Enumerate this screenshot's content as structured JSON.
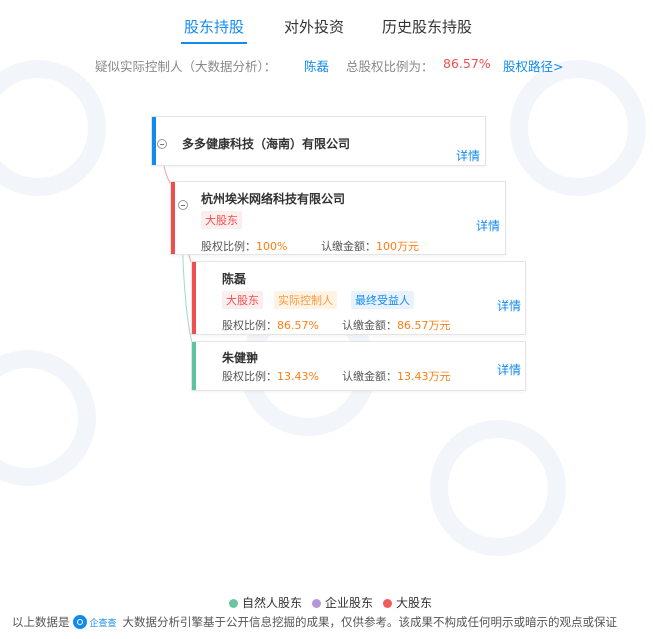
{
  "tabs": [
    {
      "label": "股东持股",
      "active": true
    },
    {
      "label": "对外投资",
      "active": false
    },
    {
      "label": "历史股东持股",
      "active": false
    }
  ],
  "controller": {
    "prefix": "疑似实际控制人（大数据分析）：",
    "name": "陈磊",
    "ratio_label": "总股权比例为：",
    "ratio_value": "86.57%",
    "path_link": "股权路径>"
  },
  "tree": {
    "root": {
      "name": "多多健康科技（海南）有限公司",
      "detail": "详情",
      "color": "#128bed"
    },
    "company": {
      "name": "杭州埃米网络科技有限公司",
      "tags": [
        "大股东"
      ],
      "ratio_label": "股权比例：",
      "ratio_value": "100%",
      "capital_label": "认缴金额：",
      "capital_value": "100万元",
      "detail": "详情",
      "color": "#f04f4f"
    },
    "persons": [
      {
        "name": "陈磊",
        "tags": [
          "大股东",
          "实际控制人",
          "最终受益人"
        ],
        "ratio_label": "股权比例：",
        "ratio_value": "86.57%",
        "capital_label": "认缴金额：",
        "capital_value": "86.57万元",
        "detail": "详情",
        "color": "#f04f4f"
      },
      {
        "name": "朱健翀",
        "tags": [],
        "ratio_label": "股权比例：",
        "ratio_value": "13.43%",
        "capital_label": "认缴金额：",
        "capital_value": "13.43万元",
        "detail": "详情",
        "color": "#5cc4a0"
      }
    ]
  },
  "legend": [
    {
      "label": "自然人股东",
      "color": "#6cc5a0"
    },
    {
      "label": "企业股东",
      "color": "#b596d9"
    },
    {
      "label": "大股东",
      "color": "#f05a5a"
    }
  ],
  "footer": {
    "prefix": "以上数据是",
    "logo_text": "企查查",
    "text": "大数据分析引擎基于公开信息挖掘的成果，仅供参考。该成果不构成任何明示或暗示的观点或保证"
  }
}
